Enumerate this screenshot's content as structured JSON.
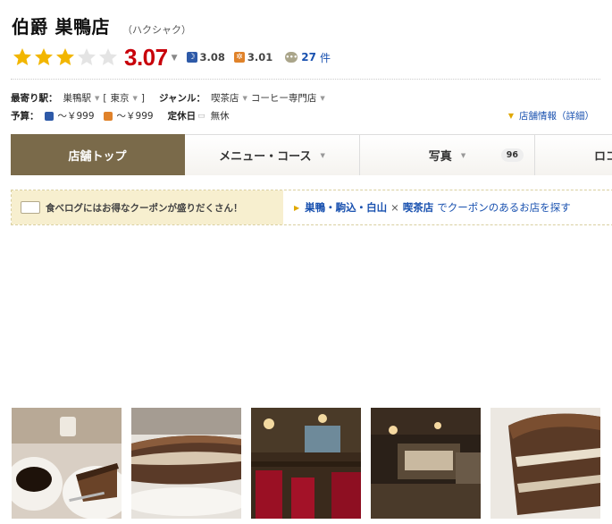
{
  "restaurant": {
    "name": "伯爵 巣鴨店",
    "kana": "（ハクシャク）"
  },
  "rating": {
    "score": "3.07",
    "stars_filled": 3,
    "stars_total": 5,
    "night_score": "3.08",
    "lunch_score": "3.01",
    "review_count": "27",
    "review_unit": "件"
  },
  "info": {
    "station_label": "最寄り駅：",
    "station": "巣鴨駅",
    "area_open": "[",
    "area": "東京",
    "area_close": "]",
    "genre_label": "ジャンル：",
    "genre1": "喫茶店",
    "genre2": "コーヒー専門店",
    "budget_label": "予算：",
    "budget_night": "～￥999",
    "budget_lunch": "～￥999",
    "holiday_label": "定休日",
    "holiday": "無休",
    "detail_link": "店舗情報（詳細）"
  },
  "tabs": [
    {
      "label": "店舗トップ"
    },
    {
      "label": "メニュー・コース"
    },
    {
      "label": "写真",
      "badge": "96"
    },
    {
      "label": "ロコ"
    }
  ],
  "coupon": {
    "banner_text": "食べログにはお得なクーポンが盛りだくさん！",
    "area": "巣鴨・駒込・白山",
    "times": "×",
    "genre": "喫茶店",
    "suffix": "でクーポンのあるお店を探す"
  },
  "colors": {
    "score_red": "#c8000a",
    "star_gold": "#f2b600",
    "active_tab": "#7a6a4a",
    "link_blue": "#1a52b0"
  }
}
